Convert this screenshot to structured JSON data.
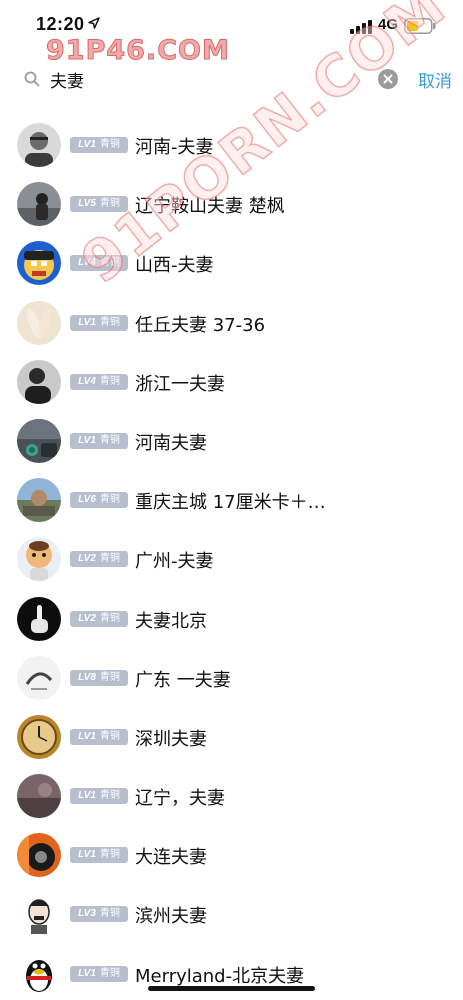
{
  "status_bar": {
    "time": "12:20",
    "network": "4G"
  },
  "watermark": {
    "top_text": "91P46.COM",
    "diagonal_text": "91PORN.COM"
  },
  "search": {
    "value": "夫妻",
    "cancel_label": "取消"
  },
  "results": [
    {
      "level": "LV1",
      "tier": "青铜",
      "name": "河南-夫妻"
    },
    {
      "level": "LV5",
      "tier": "青铜",
      "name": "辽宁鞍山夫妻 楚枫"
    },
    {
      "level": "LV4",
      "tier": "青铜",
      "name": "山西-夫妻"
    },
    {
      "level": "LV1",
      "tier": "青铜",
      "name": "任丘夫妻 37-36"
    },
    {
      "level": "LV4",
      "tier": "青铜",
      "name": "浙江一夫妻"
    },
    {
      "level": "LV1",
      "tier": "青铜",
      "name": "河南夫妻"
    },
    {
      "level": "LV6",
      "tier": "青铜",
      "name": "重庆主城 17厘米卡＋…"
    },
    {
      "level": "LV2",
      "tier": "青铜",
      "name": "广州-夫妻"
    },
    {
      "level": "LV2",
      "tier": "青铜",
      "name": "夫妻北京"
    },
    {
      "level": "LV8",
      "tier": "青铜",
      "name": "广东 一夫妻"
    },
    {
      "level": "LV1",
      "tier": "青铜",
      "name": "深圳夫妻"
    },
    {
      "level": "LV1",
      "tier": "青铜",
      "name": "辽宁，夫妻"
    },
    {
      "level": "LV1",
      "tier": "青铜",
      "name": "大连夫妻"
    },
    {
      "level": "LV3",
      "tier": "青铜",
      "name": "滨州夫妻"
    },
    {
      "level": "LV1",
      "tier": "青铜",
      "name": "Merryland-北京夫妻"
    }
  ],
  "colors": {
    "accent": "#3a9bd9",
    "badge_bg": "#b7bfcf",
    "battery": "#f5c518"
  },
  "icons": {
    "location": "location-arrow-icon",
    "signal": "cell-signal-icon",
    "battery": "battery-icon",
    "search": "search-icon",
    "clear": "clear-icon"
  }
}
